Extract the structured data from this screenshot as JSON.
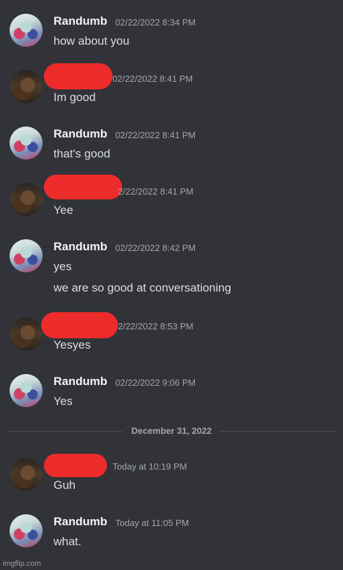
{
  "messages": [
    {
      "author": "Randumb",
      "timestamp": "02/22/2022 8:34 PM",
      "lines": [
        "how about you"
      ]
    },
    {
      "author": "",
      "timestamp": "02/22/2022 8:41 PM",
      "lines": [
        "Im good"
      ]
    },
    {
      "author": "Randumb",
      "timestamp": "02/22/2022 8:41 PM",
      "lines": [
        "that's good"
      ]
    },
    {
      "author": "",
      "timestamp": "2/22/2022 8:41 PM",
      "lines": [
        "Yee"
      ]
    },
    {
      "author": "Randumb",
      "timestamp": "02/22/2022 8:42 PM",
      "lines": [
        "yes",
        "we are so good at conversationing"
      ]
    },
    {
      "author": "",
      "timestamp": "2/22/2022 8:53 PM",
      "lines": [
        "Yesyes"
      ]
    },
    {
      "author": "Randumb",
      "timestamp": "02/22/2022 9:06 PM",
      "lines": [
        "Yes"
      ]
    },
    {
      "author": "",
      "timestamp": "Today at 10:19 PM",
      "lines": [
        "Guh"
      ]
    },
    {
      "author": "Randumb",
      "timestamp": "Today at 11:05 PM",
      "lines": [
        "what."
      ]
    }
  ],
  "date_divider": "December 31, 2022",
  "watermark": "imgflip.com",
  "colors": {
    "background": "#313338",
    "username": "#f2f3f5",
    "message_text": "#dbdee1",
    "timestamp": "#a3a6aa",
    "redaction": "#ee2b2b"
  }
}
